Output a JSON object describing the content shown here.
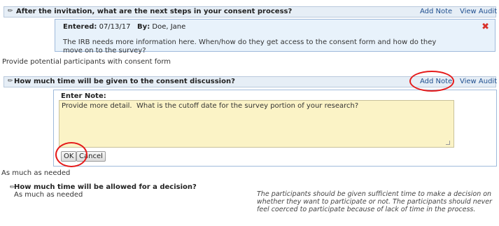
{
  "q1": {
    "title": "After the invitation, what are the next steps in your consent process?",
    "add_note": "Add Note",
    "view_audit": "View Audit",
    "note": {
      "entered_label": "Entered:",
      "entered_date": "07/13/17",
      "by_label": "By:",
      "by_name": "Doe, Jane",
      "text": "The IRB needs more information here. When/how do they get access to the consent form and how do they move on to the survey?"
    },
    "answer": "Provide potential participants with consent form"
  },
  "q2": {
    "title": "How much time will be given to the consent discussion?",
    "add_note": "Add Note",
    "view_audit": "View Audit",
    "enter_note": {
      "label": "Enter Note:",
      "value": "Provide more detail.  What is the cutoff date for the survey portion of your research?",
      "ok_label": "OK",
      "cancel_label": "Cancel"
    },
    "answer": "As much as needed"
  },
  "q3": {
    "title": "How much time will be allowed for a decision?",
    "answer": "As much as needed",
    "guidance": "The participants should be given sufficient time to make a decision on whether they want to participate or not. The participants should never feel coerced to participate because of lack of time in the process."
  },
  "colors": {
    "header_bg": "#e6eef6",
    "note_bg": "#e8f2fb",
    "textarea_bg": "#fbf3c6",
    "link": "#1f4f8f",
    "annotation_circle": "#e51b1b",
    "delete_icon": "#d9322b"
  }
}
